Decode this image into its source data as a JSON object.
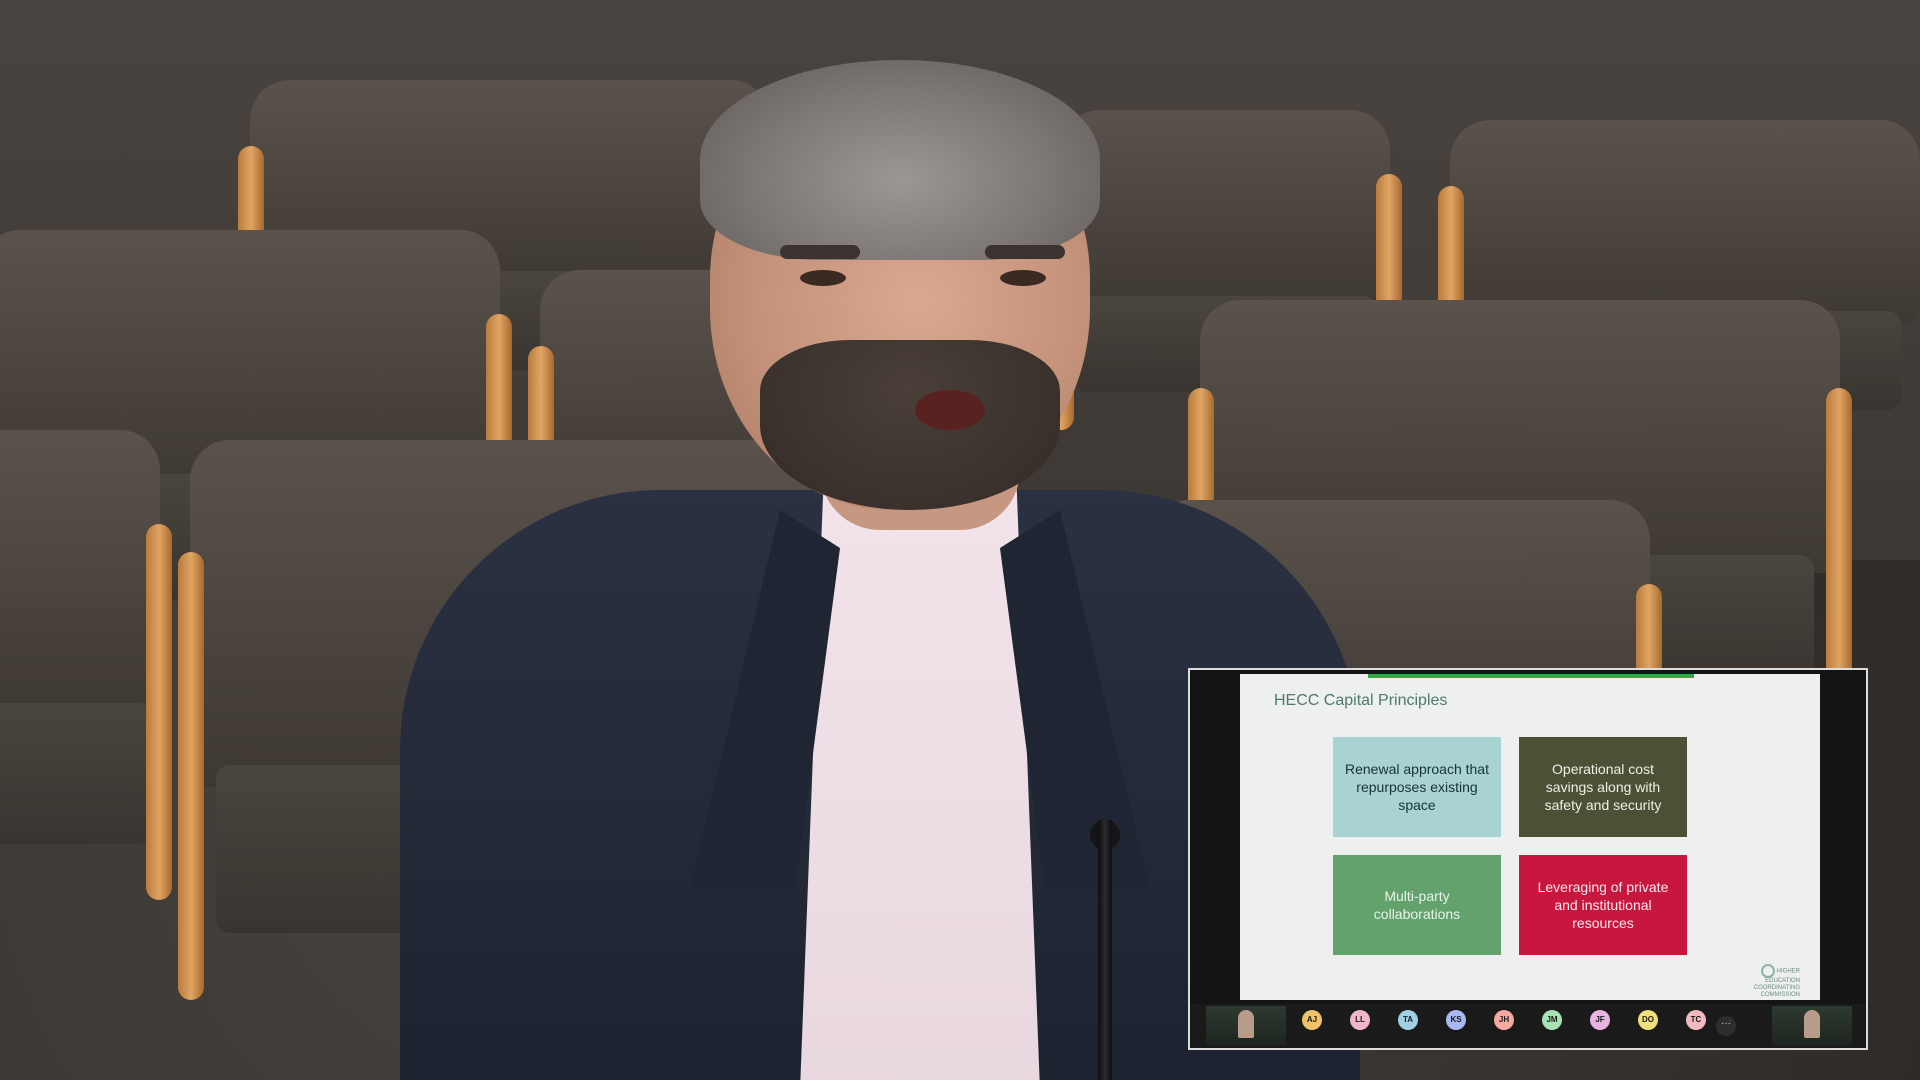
{
  "slide": {
    "title": "HECC Capital Principles",
    "cards": [
      {
        "text": "Renewal approach that repurposes existing space",
        "color": "#a9d3d2"
      },
      {
        "text": "Operational cost savings along with safety and security",
        "color": "#4c5035"
      },
      {
        "text": "Multi-party collaborations",
        "color": "#63a26c"
      },
      {
        "text": "Leveraging of private and institutional resources",
        "color": "#c8173f"
      }
    ],
    "logo_text": "HIGHER EDUCATION COORDINATING COMMISSION"
  },
  "participants": {
    "tiles": [
      {
        "initials": "AJ",
        "color": "#f0c36a"
      },
      {
        "initials": "LL",
        "color": "#f1b7c6"
      },
      {
        "initials": "TA",
        "color": "#9fd0e6"
      },
      {
        "initials": "KS",
        "color": "#a9b8f0"
      },
      {
        "initials": "JH",
        "color": "#f5a9a0"
      },
      {
        "initials": "JM",
        "color": "#a8e3b5"
      },
      {
        "initials": "JF",
        "color": "#e8b4e0"
      },
      {
        "initials": "DO",
        "color": "#f2e07a"
      },
      {
        "initials": "TC",
        "color": "#f3b8c0"
      }
    ],
    "more_label": "···"
  }
}
